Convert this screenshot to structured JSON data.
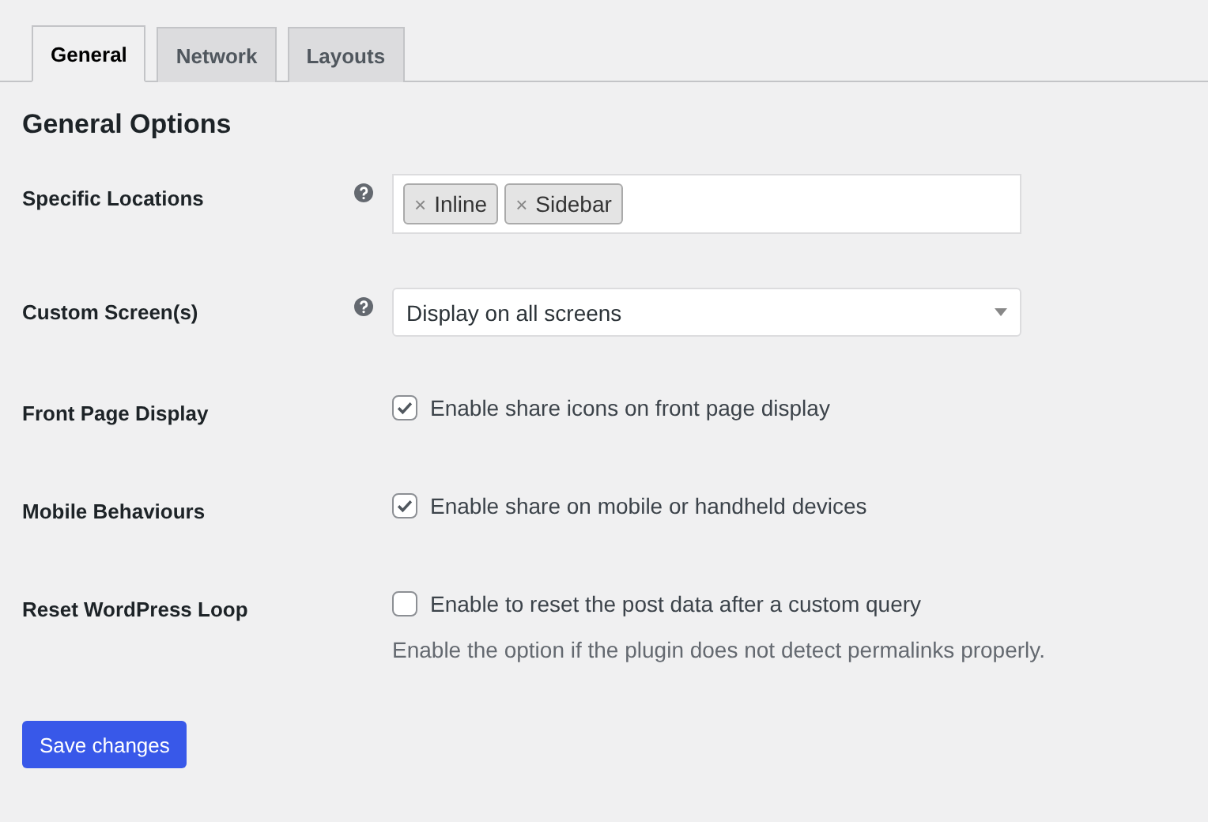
{
  "tabs": [
    {
      "label": "General",
      "selected": true
    },
    {
      "label": "Network",
      "selected": false
    },
    {
      "label": "Layouts",
      "selected": false
    }
  ],
  "heading": "General Options",
  "settings": [
    {
      "kind": "tags",
      "label": "Specific Locations",
      "help": true,
      "tags": [
        "Inline",
        "Sidebar"
      ],
      "remove": "×"
    },
    {
      "kind": "select",
      "label": "Custom Screen(s)",
      "help": true,
      "value": "Display on all screens"
    },
    {
      "kind": "checkbox",
      "label": "Front Page Display",
      "help": false,
      "checked": true,
      "text": "Enable share icons on front page display"
    },
    {
      "kind": "checkbox",
      "label": "Mobile Behaviours",
      "help": false,
      "checked": true,
      "text": "Enable share on mobile or handheld devices"
    },
    {
      "kind": "checkbox",
      "label": "Reset WordPress Loop",
      "help": false,
      "checked": false,
      "text": "Enable to reset the post data after a custom query",
      "description": "Enable the option if the plugin does not detect permalinks properly."
    }
  ],
  "save_button": "Save changes"
}
